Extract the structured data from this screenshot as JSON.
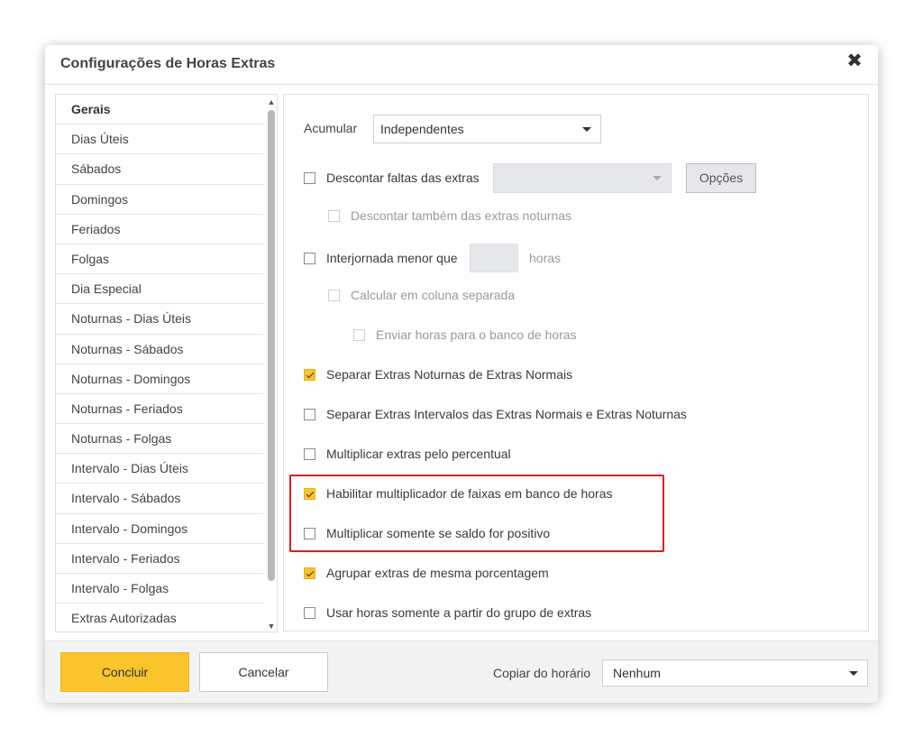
{
  "dialog": {
    "title": "Configurações de Horas Extras"
  },
  "sidebar": {
    "items": [
      {
        "label": "Gerais",
        "active": true
      },
      {
        "label": "Dias Úteis"
      },
      {
        "label": "Sábados"
      },
      {
        "label": "Domingos"
      },
      {
        "label": "Feriados"
      },
      {
        "label": "Folgas"
      },
      {
        "label": "Dia Especial"
      },
      {
        "label": "Noturnas - Dias Úteis"
      },
      {
        "label": "Noturnas - Sábados"
      },
      {
        "label": "Noturnas - Domingos"
      },
      {
        "label": "Noturnas - Feriados"
      },
      {
        "label": "Noturnas - Folgas"
      },
      {
        "label": "Intervalo - Dias Úteis"
      },
      {
        "label": "Intervalo - Sábados"
      },
      {
        "label": "Intervalo - Domingos"
      },
      {
        "label": "Intervalo - Feriados"
      },
      {
        "label": "Intervalo - Folgas"
      },
      {
        "label": "Extras Autorizadas"
      }
    ]
  },
  "settings": {
    "acumular": {
      "label": "Acumular",
      "value": "Independentes"
    },
    "descontar_faltas": {
      "label": "Descontar faltas das extras",
      "checked": false,
      "select_value": "",
      "options_button": "Opções"
    },
    "descontar_noturnas": {
      "label": "Descontar também das extras noturnas",
      "checked": false,
      "disabled": true
    },
    "interjornada": {
      "label": "Interjornada menor que",
      "checked": false,
      "value": "",
      "unit": "horas"
    },
    "calcular_coluna": {
      "label": "Calcular em coluna separada",
      "checked": false,
      "disabled": true
    },
    "enviar_banco": {
      "label": "Enviar horas para o banco de horas",
      "checked": false,
      "disabled": true
    },
    "separar_noturnas": {
      "label": "Separar Extras Noturnas de Extras Normais",
      "checked": true
    },
    "separar_intervalos": {
      "label": "Separar Extras Intervalos das Extras Normais e Extras Noturnas",
      "checked": false
    },
    "multiplicar_percentual": {
      "label": "Multiplicar extras pelo percentual",
      "checked": false
    },
    "habilitar_multiplicador": {
      "label": "Habilitar multiplicador de faixas em banco de horas",
      "checked": true
    },
    "multiplicar_positivo": {
      "label": "Multiplicar somente se saldo for positivo",
      "checked": false
    },
    "agrupar_extras": {
      "label": "Agrupar extras de mesma porcentagem",
      "checked": true
    },
    "usar_horas_grupo": {
      "label": "Usar horas somente a partir do grupo de extras",
      "checked": false
    }
  },
  "footer": {
    "concluir": "Concluir",
    "cancelar": "Cancelar",
    "copiar_label": "Copiar do horário",
    "copiar_value": "Nenhum"
  },
  "colors": {
    "accent": "#f9c42c",
    "highlight": "#e21b1b"
  }
}
